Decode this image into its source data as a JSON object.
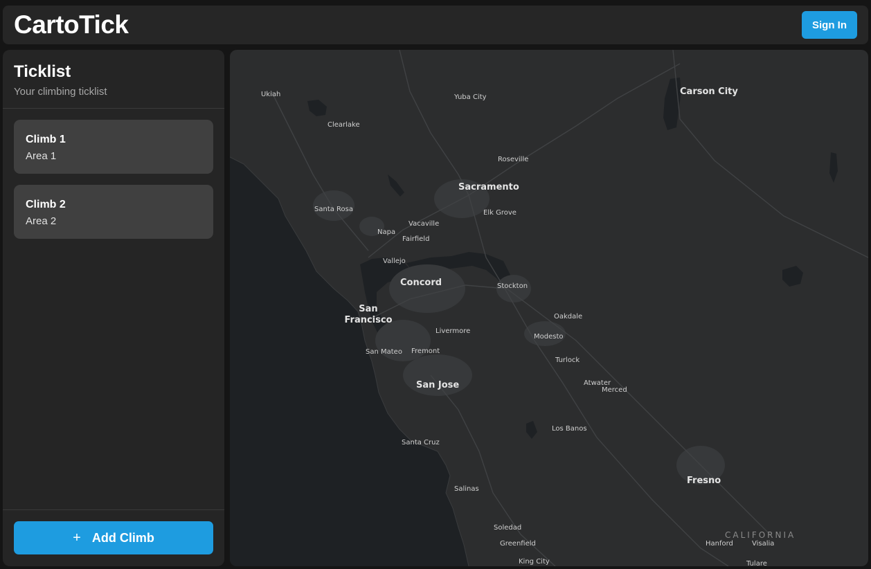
{
  "app": {
    "title": "CartoTick"
  },
  "header": {
    "signin_label": "Sign In"
  },
  "sidebar": {
    "title": "Ticklist",
    "subtitle": "Your climbing ticklist",
    "climbs": [
      {
        "name": "Climb 1",
        "area": "Area 1"
      },
      {
        "name": "Climb 2",
        "area": "Area 2"
      }
    ],
    "add_label": "Add Climb",
    "add_icon": "plus-icon"
  },
  "map": {
    "region_label": "CALIFORNIA",
    "cities_major": [
      "Carson City",
      "Sacramento",
      "Concord",
      "San Francisco",
      "San Jose",
      "Fresno"
    ],
    "cities_minor": [
      "Ukiah",
      "Yuba City",
      "Clearlake",
      "Roseville",
      "Santa Rosa",
      "Elk Grove",
      "Napa",
      "Vacaville",
      "Fairfield",
      "Vallejo",
      "Stockton",
      "Oakdale",
      "Livermore",
      "Modesto",
      "San Mateo",
      "Fremont",
      "Turlock",
      "Atwater",
      "Merced",
      "Los Banos",
      "Santa Cruz",
      "Salinas",
      "Soledad",
      "Greenfield",
      "King City",
      "Hanford",
      "Visalia",
      "Tulare"
    ],
    "colors": {
      "land": "#2c2d2e",
      "water": "#1e2124",
      "urban": "#383a3c",
      "roads": "#3f4143"
    }
  },
  "colors": {
    "accent": "#1e9ce0",
    "panel": "#252525",
    "card": "#404040"
  }
}
